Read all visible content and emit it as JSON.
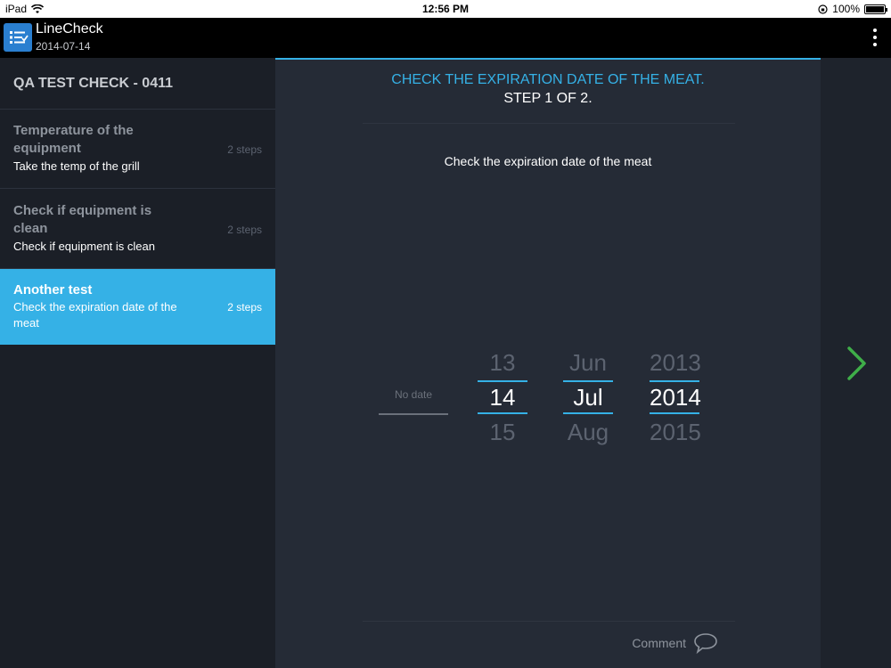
{
  "status_bar": {
    "device": "iPad",
    "time": "12:56 PM",
    "battery": "100%",
    "battery_level": 1.0
  },
  "app": {
    "title": "LineCheck",
    "date": "2014-07-14"
  },
  "sidebar": {
    "header": "QA TEST CHECK - 0411",
    "items": [
      {
        "title": "Temperature of the equipment",
        "description": "Take the temp of the grill",
        "steps": "2 steps",
        "active": false
      },
      {
        "title": "Check if equipment is clean",
        "description": "Check if equipment is clean",
        "steps": "2 steps",
        "active": false
      },
      {
        "title": "Another test",
        "description": "Check the expiration date of the meat",
        "steps": "2 steps",
        "active": true
      }
    ]
  },
  "main": {
    "heading": "CHECK THE EXPIRATION DATE OF THE MEAT.",
    "step_count": "STEP 1 OF 2.",
    "instruction": "Check the expiration date of the meat",
    "date_picker": {
      "no_date_label": "No date",
      "day": {
        "prev": "13",
        "selected": "14",
        "next": "15"
      },
      "month": {
        "prev": "Jun",
        "selected": "Jul",
        "next": "Aug"
      },
      "year": {
        "prev": "2013",
        "selected": "2014",
        "next": "2015"
      }
    },
    "comment_label": "Comment"
  },
  "icons": {
    "app_logo": "checklist-icon",
    "menu": "more-vertical-icon",
    "next": "chevron-right-icon",
    "comment": "speech-bubble-icon"
  },
  "colors": {
    "accent": "#35b1e6",
    "next_arrow": "#3fae49",
    "background": "#222833"
  }
}
